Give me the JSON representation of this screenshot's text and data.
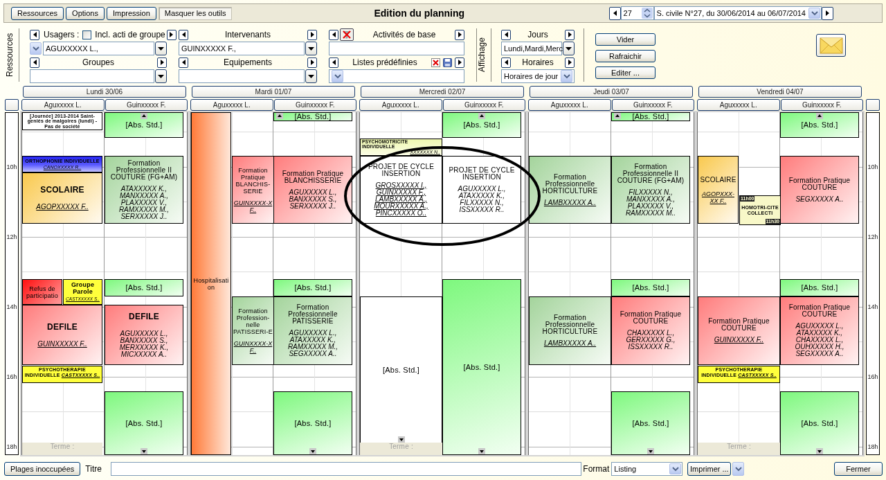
{
  "toolbar": {
    "buttons": [
      {
        "label": "Ressources",
        "pressed": false
      },
      {
        "label": "Options",
        "pressed": false
      },
      {
        "label": "Impression",
        "pressed": false
      },
      {
        "label": "Masquer les outils",
        "pressed": true
      }
    ],
    "title": "Edition du planning",
    "week": {
      "number": "27",
      "period": "S. civile N°27, du 30/06/2014 au 06/07/2014"
    }
  },
  "filters": {
    "label": "Ressources",
    "fields": [
      {
        "kind": "picker",
        "label": "Usagers :",
        "value": "AGUXXXXX L.,",
        "checkbox": {
          "label": "Incl. acti de groupe",
          "checked": false
        }
      },
      {
        "kind": "combo",
        "label": "Intervenants",
        "value": "GUINXXXXX F.,"
      },
      {
        "kind": "text",
        "label": "Activités de base"
      },
      {
        "kind": "combo",
        "label": "Groupes"
      },
      {
        "kind": "combo",
        "label": "Equipements"
      },
      {
        "kind": "select",
        "label": "Listes prédéfinies"
      }
    ]
  },
  "display": {
    "label": "Affichage",
    "fields": [
      {
        "kind": "combo",
        "label": "Jours",
        "value": "Lundi,Mardi,Merc"
      },
      {
        "kind": "select",
        "label": "Horaires",
        "value": "Horaires de jour"
      }
    ]
  },
  "actions": [
    "Vider",
    "Rafraichir",
    "Editer ..."
  ],
  "planning": {
    "hours_left": [
      "10h",
      "12h",
      "14h",
      "16h",
      "18h"
    ],
    "hours_right": [
      "10h",
      "12h",
      "14h",
      "16h",
      "18h"
    ],
    "days": [
      {
        "label": "Lundi 30/06",
        "columns": [
          {
            "header": "Aguxxxxx L.",
            "events": [
              {
                "kind": "note",
                "title": "[Journée] 2013-2014 Saint-geniés de malgoires (lundi) - Pas de société"
              },
              {
                "kind": "speech",
                "title": "ORTHOPHONIE INDIVIDUELLE",
                "staff": "CANOXXXXX R.."
              },
              {
                "kind": "school",
                "title": "SCOLAIRE",
                "staff": "AGOPXXXXX F.."
              },
              {
                "kind": "refusal",
                "title": "Refus de participatio"
              },
              {
                "kind": "group",
                "title": "Groupe Parole",
                "staff": "CASTXXXXX S.."
              },
              {
                "kind": "show",
                "title": "DEFILE",
                "staff": "GUINXXXXX F.."
              },
              {
                "kind": "therapy",
                "title": "PSYCHOTHERAPIE INDIVIDUELLE",
                "staff": "CASTXXXXX S.."
              },
              {
                "kind": "term",
                "title": "Terme :"
              }
            ]
          },
          {
            "header": "Guinxxxxx F.",
            "events": [
              {
                "kind": "abs",
                "title": "[Abs. Std.]",
                "more_above": true
              },
              {
                "kind": "training",
                "title": "Formation Professionnelle II COUTURE (FG+AM)",
                "participants": "ATAXXXXX K., MANXXXXX A., PLAXXXXX V., RAMXXXXX M., SERXXXXX J.."
              },
              {
                "kind": "abs",
                "title": "[Abs. Std.]"
              },
              {
                "kind": "show",
                "title": "DEFILE",
                "participants": "AGUXXXXX L., BANXXXXX S., MERXXXXX K., MICXXXXX A.."
              },
              {
                "kind": "abs",
                "title": "[Abs. Std.]",
                "more_below": true
              }
            ]
          }
        ]
      },
      {
        "label": "Mardi 01/07",
        "columns": [
          {
            "header": "Aguxxxxx L.",
            "events": [
              {
                "kind": "hospital",
                "title": "Hospitalisation"
              },
              {
                "kind": "practice",
                "title": "Formation Pratique BLANCHIS-SERIE",
                "staff": "GUINXXXX-X F.."
              },
              {
                "kind": "training",
                "title": "Formation Profession-nelle PATISSERI-E",
                "staff": "GUINXXXX-X F.."
              }
            ]
          },
          {
            "header": "Guinxxxxx F.",
            "events": [
              {
                "kind": "abs",
                "title": "[Abs. Std.]",
                "more_above": true
              },
              {
                "kind": "practice",
                "title": "Formation Pratique BLANCHISSERIE",
                "participants": "AGUXXXXX L., BANXXXXX S., SERXXXXX J.."
              },
              {
                "kind": "abs",
                "title": "[Abs. Std.]"
              },
              {
                "kind": "training",
                "title": "Formation Professionnelle PATISSERIE",
                "participants": "AGUXXXXX L., ATAXXXXX K., RAMXXXXX M., SEGXXXXX A.."
              },
              {
                "kind": "abs",
                "title": "[Abs. Std.]",
                "more_below": true
              }
            ]
          }
        ]
      },
      {
        "label": "Mercredi 02/07",
        "columns": [
          {
            "header": "Aguxxxxx L.",
            "events": [
              {
                "kind": "motricity",
                "title": "PSYCHOMOTRICITE INDIVIDUELLE",
                "staff": "XXXXXXX N.."
              },
              {
                "kind": "project",
                "title": "PROJET DE CYCLE INSERTION",
                "staff": "GROSXXXXX I., GUINXXXXX F., LAMBXXXXX A., MOURXXXXX A., PINCXXXXX O.."
              },
              {
                "kind": "abs_white",
                "title": "[Abs. Std.]",
                "more_below": true
              },
              {
                "kind": "term",
                "title": "Terme :"
              }
            ]
          },
          {
            "header": "Guinxxxxx F.",
            "events": [
              {
                "kind": "abs",
                "title": "[Abs. Std.]",
                "more_above": true
              },
              {
                "kind": "project",
                "title": "PROJET DE CYCLE INSERTION",
                "participants": "AGUXXXXX L., ATAXXXXX K., FILXXXXX N., ISSXXXXX R.."
              },
              {
                "kind": "abs",
                "title": "[Abs. Std.]",
                "more_below": true
              }
            ]
          }
        ]
      },
      {
        "label": "Jeudi 03/07",
        "columns": [
          {
            "header": "Aguxxxxx L.",
            "events": [
              {
                "kind": "training",
                "title": "Formation Professionnelle HORTICULTURE",
                "staff": "LAMBXXXXX A.."
              },
              {
                "kind": "training",
                "title": "Formation Professionnelle HORTICULTURE",
                "staff": "LAMBXXXXX A.."
              }
            ]
          },
          {
            "header": "Guinxxxxx F.",
            "events": [
              {
                "kind": "abs",
                "title": "[Abs. Std.]",
                "more_above": true
              },
              {
                "kind": "training",
                "title": "Formation Professionnelle II COUTURE (FG+AM)",
                "participants": "FILXXXXX N., MANXXXXX A., PLAXXXXX V., RAMXXXXX M.."
              },
              {
                "kind": "abs",
                "title": "[Abs. Std.]"
              },
              {
                "kind": "practice",
                "title": "Formation Pratique COUTURE",
                "participants": "CHAXXXXX L., GERXXXXX G., ISSXXXXX R.."
              },
              {
                "kind": "abs",
                "title": "[Abs. Std.]",
                "more_below": true
              }
            ]
          }
        ]
      },
      {
        "label": "Vendredi 04/07",
        "columns": [
          {
            "header": "Aguxxxxx L.",
            "events": [
              {
                "kind": "school",
                "title": "SCOLAIRE",
                "staff": "AGOPXXX-XX F.."
              },
              {
                "kind": "collective",
                "start": "11h00",
                "title": "HOMOTRI-CITE COLLECTI",
                "end": "11h30"
              },
              {
                "kind": "practice",
                "title": "Formation Pratique COUTURE",
                "staff": "GUINXXXXX F.."
              },
              {
                "kind": "therapy",
                "title": "PSYCHOTHERAPIE INDIVIDUELLE",
                "staff": "CASTXXXXX S.."
              },
              {
                "kind": "term",
                "title": "Terme :"
              }
            ]
          },
          {
            "header": "Guinxxxxx F.",
            "events": [
              {
                "kind": "abs",
                "title": "[Abs. Std.]",
                "more_above": true
              },
              {
                "kind": "practice",
                "title": "Formation Pratique COUTURE",
                "participants": "SEGXXXXX A.."
              },
              {
                "kind": "abs",
                "title": "[Abs. Std.]"
              },
              {
                "kind": "practice",
                "title": "Formation Pratique COUTURE",
                "participants": "AGUXXXXX L., ATAXXXXX K., CHAXXXXX L., OUHXXXXX H., SEGXXXXX A.."
              },
              {
                "kind": "abs",
                "title": "[Abs. Std.]",
                "more_below": true
              }
            ]
          }
        ]
      }
    ]
  },
  "footer": {
    "unoccupied_button": "Plages inoccupées",
    "title_label": "Titre",
    "format_label": "Format",
    "format_value": "Listing",
    "print_button": "Imprimer ...",
    "close_button": "Fermer"
  }
}
